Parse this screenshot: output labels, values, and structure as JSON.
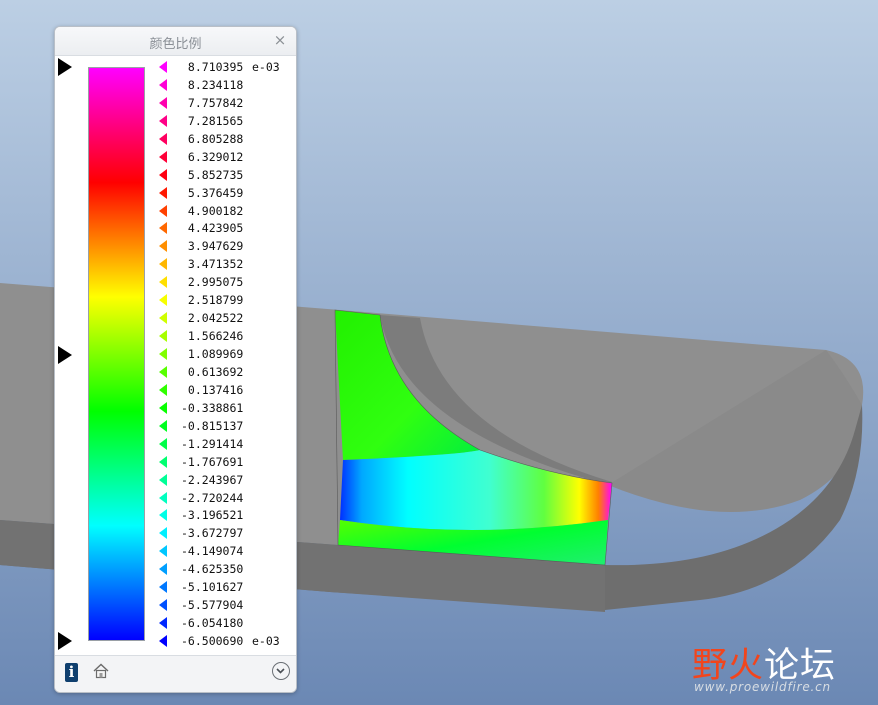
{
  "panel": {
    "title": "颜色比例",
    "close_glyph": "×",
    "exponent_top": "e-03",
    "exponent_bottom": "e-03",
    "info_glyph": "i",
    "icons": [
      "close-icon",
      "info-icon",
      "home-icon",
      "chevron-down-icon"
    ]
  },
  "scale": {
    "max": 8.710395,
    "min": -6.50069,
    "labels": [
      "8.710395",
      "8.234118",
      "7.757842",
      "7.281565",
      "6.805288",
      "6.329012",
      "5.852735",
      "5.376459",
      "4.900182",
      "4.423905",
      "3.947629",
      "3.471352",
      "2.995075",
      "2.518799",
      "2.042522",
      "1.566246",
      "1.089969",
      "0.613692",
      "0.137416",
      "-0.338861",
      "-0.815137",
      "-1.291414",
      "-1.767691",
      "-2.243967",
      "-2.720244",
      "-3.196521",
      "-3.672797",
      "-4.149074",
      "-4.625350",
      "-5.101627",
      "-5.577904",
      "-6.054180",
      "-6.500690"
    ],
    "gradient_colors": [
      "#ff00ff",
      "#ff0000",
      "#ffff00",
      "#00ff00",
      "#00ffff",
      "#0000ff"
    ],
    "slider_values": [
      8.710395,
      1.089969,
      -6.50069
    ]
  },
  "watermark": {
    "main_left": "野",
    "main_mid": "火",
    "main_right": "论坛",
    "url": "www.proewildfire.cn",
    "color_left": "#f2451c",
    "color_right": "#ffffff"
  }
}
